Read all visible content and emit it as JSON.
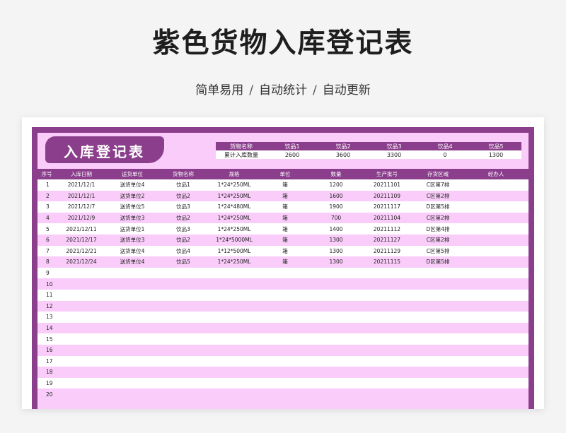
{
  "title": "紫色货物入库登记表",
  "subtitle": [
    "简单易用",
    "自动统计",
    "自动更新"
  ],
  "subtitle_sep": "/",
  "sheet_title": "入库登记表",
  "summary": {
    "headers": [
      "货物名称",
      "饮品1",
      "饮品2",
      "饮品3",
      "饮品4",
      "饮品5"
    ],
    "row_label": "累计入库数量",
    "values": [
      "2600",
      "3600",
      "3300",
      "0",
      "1300"
    ]
  },
  "columns": [
    "序号",
    "入库日期",
    "送货单位",
    "货物名称",
    "规格",
    "单位",
    "数量",
    "生产批号",
    "存货区域",
    "经办人"
  ],
  "rows": [
    [
      "1",
      "2021/12/1",
      "送货单位4",
      "饮品1",
      "1*24*250ML",
      "箱",
      "1200",
      "20211101",
      "C区第7排",
      ""
    ],
    [
      "2",
      "2021/12/1",
      "送货单位2",
      "饮品2",
      "1*24*250ML",
      "箱",
      "1600",
      "20211109",
      "C区第2排",
      ""
    ],
    [
      "3",
      "2021/12/7",
      "送货单位5",
      "饮品3",
      "1*24*480ML",
      "箱",
      "1900",
      "20211117",
      "D区第5排",
      ""
    ],
    [
      "4",
      "2021/12/9",
      "送货单位3",
      "饮品2",
      "1*24*250ML",
      "箱",
      "700",
      "20211104",
      "C区第2排",
      ""
    ],
    [
      "5",
      "2021/12/11",
      "送货单位1",
      "饮品3",
      "1*24*250ML",
      "箱",
      "1400",
      "20211112",
      "D区第4排",
      ""
    ],
    [
      "6",
      "2021/12/17",
      "送货单位3",
      "饮品2",
      "1*24*5000ML",
      "箱",
      "1300",
      "20211127",
      "C区第2排",
      ""
    ],
    [
      "7",
      "2021/12/21",
      "送货单位4",
      "饮品4",
      "1*12*500ML",
      "箱",
      "1300",
      "20211129",
      "C区第5排",
      ""
    ],
    [
      "8",
      "2021/12/24",
      "送货单位4",
      "饮品5",
      "1*24*250ML",
      "箱",
      "1300",
      "20211115",
      "D区第5排",
      ""
    ],
    [
      "9",
      "",
      "",
      "",
      "",
      "",
      "",
      "",
      "",
      ""
    ],
    [
      "10",
      "",
      "",
      "",
      "",
      "",
      "",
      "",
      "",
      ""
    ],
    [
      "11",
      "",
      "",
      "",
      "",
      "",
      "",
      "",
      "",
      ""
    ],
    [
      "12",
      "",
      "",
      "",
      "",
      "",
      "",
      "",
      "",
      ""
    ],
    [
      "13",
      "",
      "",
      "",
      "",
      "",
      "",
      "",
      "",
      ""
    ],
    [
      "14",
      "",
      "",
      "",
      "",
      "",
      "",
      "",
      "",
      ""
    ],
    [
      "15",
      "",
      "",
      "",
      "",
      "",
      "",
      "",
      "",
      ""
    ],
    [
      "16",
      "",
      "",
      "",
      "",
      "",
      "",
      "",
      "",
      ""
    ],
    [
      "17",
      "",
      "",
      "",
      "",
      "",
      "",
      "",
      "",
      ""
    ],
    [
      "18",
      "",
      "",
      "",
      "",
      "",
      "",
      "",
      "",
      ""
    ],
    [
      "19",
      "",
      "",
      "",
      "",
      "",
      "",
      "",
      "",
      ""
    ],
    [
      "20",
      "",
      "",
      "",
      "",
      "",
      "",
      "",
      "",
      ""
    ]
  ]
}
